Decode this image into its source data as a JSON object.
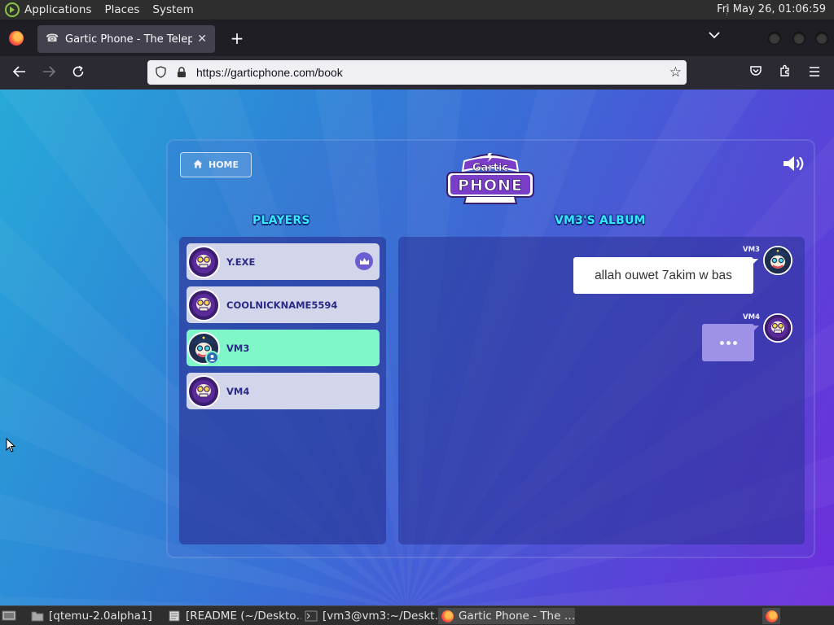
{
  "top_panel": {
    "menus": [
      "Applications",
      "Places",
      "System"
    ],
    "clock": "Fri May 26, 01:06:59"
  },
  "browser": {
    "tab": {
      "title": "Gartic Phone - The Telephone Game",
      "favicon": "telephone-icon"
    },
    "url": "https://garticphone.com/book"
  },
  "game": {
    "home_label": "HOME",
    "logo_top": "Gartic",
    "logo_bottom": "PHONE",
    "players_title": "PLAYERS",
    "album_title": "VM3'S ALBUM",
    "players": [
      {
        "name": "Y.EXE",
        "host": true
      },
      {
        "name": "COOLNICKNAME5594"
      },
      {
        "name": "VM3",
        "current": true
      },
      {
        "name": "VM4"
      }
    ],
    "album": [
      {
        "author": "VM3",
        "text": "allah ouwet 7akim w bas"
      },
      {
        "author": "VM4",
        "typing": true
      }
    ]
  },
  "taskbar": {
    "items": [
      {
        "label": "[qtemu-2.0alpha1]",
        "icon": "folder-icon"
      },
      {
        "label": "[README (~/Deskto…",
        "icon": "text-editor-icon"
      },
      {
        "label": "[vm3@vm3:~/Deskt…",
        "icon": "terminal-icon"
      },
      {
        "label": "Gartic Phone - The …",
        "icon": "firefox-icon",
        "active": true
      }
    ]
  },
  "colors": {
    "player_highlight": "#80f7c9",
    "section_title": "#33e8ff"
  }
}
